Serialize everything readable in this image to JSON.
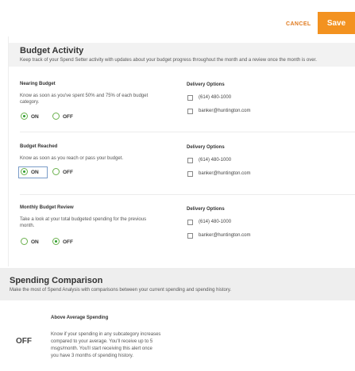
{
  "toolbar": {
    "cancel_label": "CANCEL",
    "save_label": "Save"
  },
  "budget_activity": {
    "title": "Budget Activity",
    "description": "Keep track of your Spend Setter activity with updates about your budget progress throughout the month and a review once the month is over.",
    "alerts": [
      {
        "title": "Nearing Budget",
        "description_lines": [
          "Know as soon as you've spent 50% and 75% of each budget",
          "category."
        ],
        "on_label": "ON",
        "off_label": "OFF",
        "selected": "ON",
        "delivery_title": "Delivery Options",
        "delivery_options": [
          {
            "label": "(614) 480-1000",
            "checked": false
          },
          {
            "label": "banker@huntington.com",
            "checked": false
          }
        ]
      },
      {
        "title": "Budget Reached",
        "description_lines": [
          "Know as soon as you reach or pass your budget."
        ],
        "on_label": "ON",
        "off_label": "OFF",
        "selected": "ON",
        "delivery_title": "Delivery Options",
        "delivery_options": [
          {
            "label": "(614) 480-1000",
            "checked": false
          },
          {
            "label": "banker@huntington.com",
            "checked": false
          }
        ]
      },
      {
        "title": "Monthly Budget Review",
        "description_lines": [
          "Take a look at your total budgeted spending for the previous",
          "month."
        ],
        "on_label": "ON",
        "off_label": "OFF",
        "selected": "OFF",
        "delivery_title": "Delivery Options",
        "delivery_options": [
          {
            "label": "(614) 480-1000",
            "checked": false
          },
          {
            "label": "banker@huntington.com",
            "checked": false
          }
        ]
      }
    ]
  },
  "spending_comparison": {
    "title": "Spending Comparison",
    "description": "Make the most of Spend Analysis with comparisons between your current spending and spending history.",
    "alert": {
      "status": "OFF",
      "title": "Above Average Spending",
      "description_lines": [
        "Know if your spending in any subcategory increases",
        "compared to your average. You'll receive up to 5",
        "msgs/month. You'll start receiving this alert once",
        "you have 3 months of spending history."
      ]
    }
  },
  "colors": {
    "accent": "#f39220",
    "cancel": "#e07b1f",
    "radio_on": "#2e9e2e"
  }
}
